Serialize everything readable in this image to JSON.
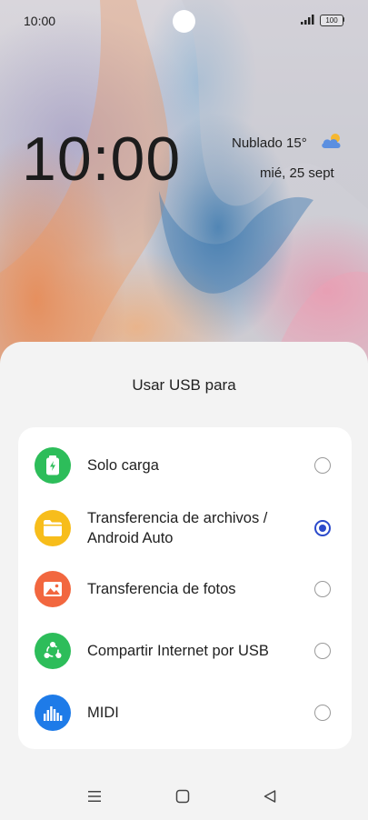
{
  "status_bar": {
    "time": "10:00",
    "battery": "100"
  },
  "lockscreen": {
    "clock": "10:00",
    "weather": "Nublado 15°",
    "weather_icon": "cloud-sun-icon",
    "date": "mié, 25 sept"
  },
  "sheet": {
    "title": "Usar USB para",
    "options": [
      {
        "line1": "Solo carga",
        "line2": "",
        "icon": "battery-charging-icon",
        "color": "#2dbd5a",
        "selected": false
      },
      {
        "line1": "Transferencia de archivos /",
        "line2": "Android Auto",
        "icon": "folder-icon",
        "color": "#f7bd1b",
        "selected": true
      },
      {
        "line1": "Transferencia de fotos",
        "line2": "",
        "icon": "image-icon",
        "color": "#f2673f",
        "selected": false
      },
      {
        "line1": "Compartir Internet por USB",
        "line2": "",
        "icon": "share-network-icon",
        "color": "#2dbd5a",
        "selected": false
      },
      {
        "line1": "MIDI",
        "line2": "",
        "icon": "equalizer-icon",
        "color": "#1e7be8",
        "selected": false
      }
    ]
  },
  "colors": {
    "accent": "#2b4acb"
  },
  "nav": {
    "buttons": [
      "menu-icon",
      "home-icon",
      "back-icon"
    ]
  }
}
